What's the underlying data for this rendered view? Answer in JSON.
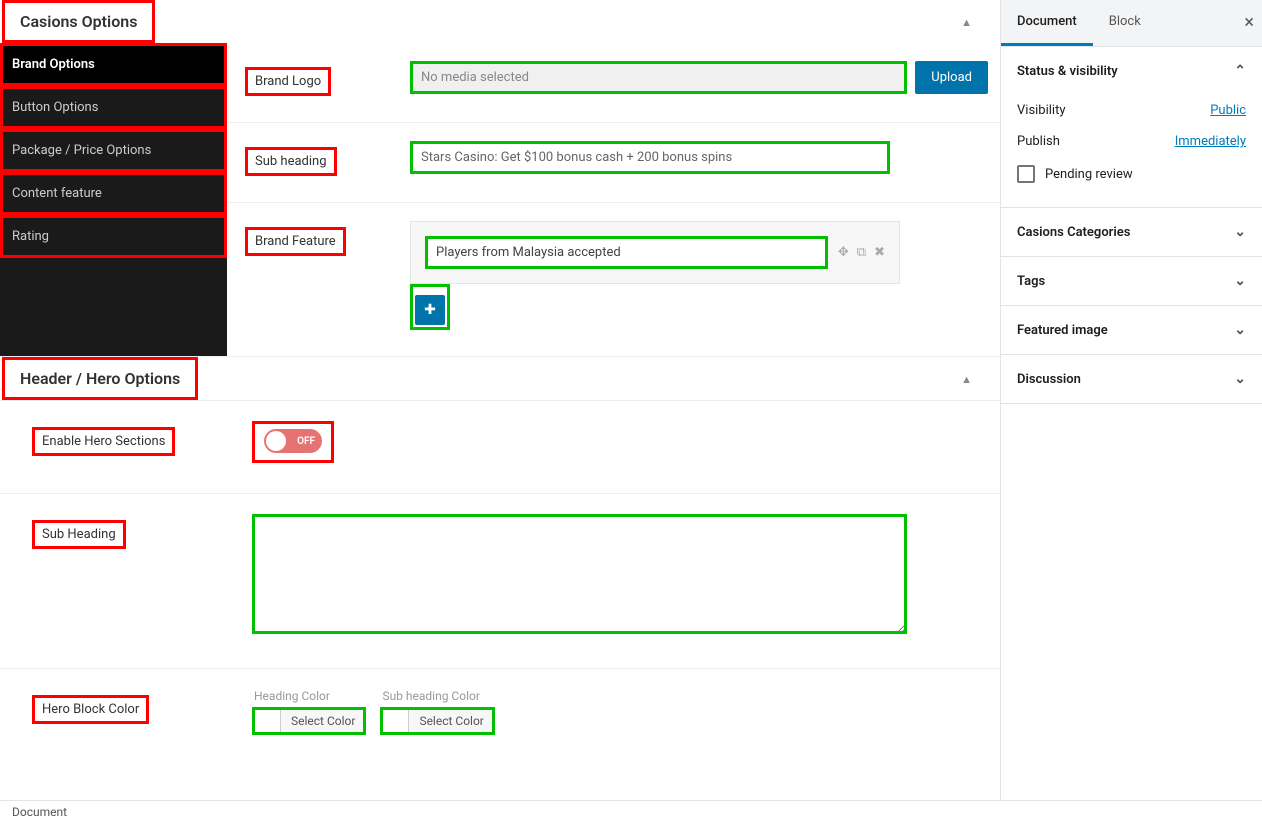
{
  "panel1": {
    "title": "Casions Options",
    "sidebar": [
      {
        "label": "Brand Options",
        "active": true
      },
      {
        "label": "Button Options",
        "active": false
      },
      {
        "label": "Package / Price Options",
        "active": false
      },
      {
        "label": "Content feature",
        "active": false
      },
      {
        "label": "Rating",
        "active": false
      }
    ],
    "fields": {
      "brandLogo": {
        "label": "Brand Logo",
        "placeholder": "No media selected",
        "uploadLabel": "Upload"
      },
      "subHeading": {
        "label": "Sub heading",
        "value": "Stars Casino: Get $100 bonus cash + 200 bonus spins"
      },
      "brandFeature": {
        "label": "Brand Feature",
        "items": [
          "Players from Malaysia accepted"
        ]
      }
    }
  },
  "panel2": {
    "title": "Header / Hero Options",
    "fields": {
      "enable": {
        "label": "Enable Hero Sections",
        "toggleText": "OFF"
      },
      "subHeading": {
        "label": "Sub Heading",
        "value": ""
      },
      "blockColor": {
        "label": "Hero Block Color",
        "heading": {
          "label": "Heading Color",
          "button": "Select Color"
        },
        "sub": {
          "label": "Sub heading Color",
          "button": "Select Color"
        }
      }
    }
  },
  "rightSidebar": {
    "tabs": {
      "document": "Document",
      "block": "Block"
    },
    "status": {
      "title": "Status & visibility",
      "visibility": {
        "label": "Visibility",
        "value": "Public"
      },
      "publish": {
        "label": "Publish",
        "value": "Immediately"
      },
      "pending": "Pending review"
    },
    "sections": [
      "Casions Categories",
      "Tags",
      "Featured image",
      "Discussion"
    ]
  },
  "footer": "Document"
}
